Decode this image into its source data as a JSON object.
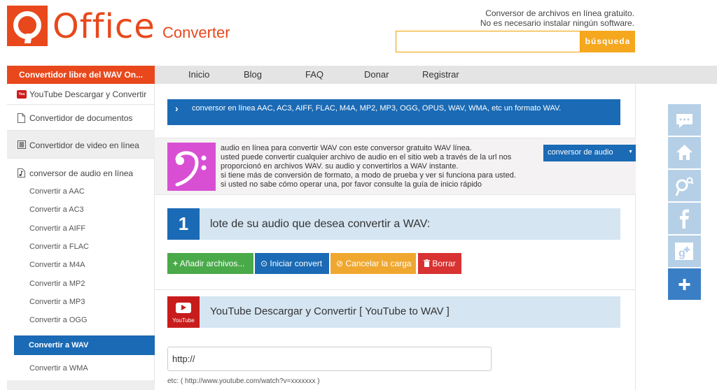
{
  "header": {
    "logo_office": "Office",
    "logo_converter": "Converter",
    "tagline_line1": "Conversor de archivos en línea gratuito.",
    "tagline_line2": "No es necesario instalar ningún software.",
    "search_placeholder": "",
    "search_button": "búsqueda"
  },
  "nav": {
    "items": [
      "Inicio",
      "Blog",
      "FAQ",
      "Donar",
      "Registrar"
    ]
  },
  "sidebar": {
    "heading": "Convertidor libre del WAV On...",
    "youtube": "YouTube Descargar y Convertir",
    "documents": "Convertidor de documentos",
    "video": "Convertidor de video en línea",
    "audio": "conversor de audio en línea",
    "sub_items": [
      "Convertir a AAC",
      "Convertir a AC3",
      "Convertir a AIFF",
      "Convertir a FLAC",
      "Convertir a M4A",
      "Convertir a MP2",
      "Convertir a MP3",
      "Convertir a OGG"
    ],
    "active_item": "Convertir a WAV",
    "after_item": "Convertir a WMA"
  },
  "main": {
    "banner": "conversor en línea AAC, AC3, AIFF, FLAC, M4A, MP2, MP3, OGG, OPUS, WAV, WMA, etc un formato WAV.",
    "description": [
      "audio en línea para convertir WAV con este conversor gratuito WAV línea.",
      "usted puede convertir cualquier archivo de audio en el sitio web a través de la url nos",
      "proporcionó en archivos WAV. su audio y convertirlos a WAV instante.",
      "si tiene más de conversión de formato, a modo de prueba y ver si funciona para usted.",
      "si usted no sabe cómo operar una, por favor consulte la guía de inicio rápido"
    ],
    "audio_dropdown": "conversor de audio",
    "step_number": "1",
    "step_text": "lote de su audio que desea convertir a WAV:",
    "buttons": {
      "add": "Añadir archivos...",
      "start": "Iniciar convert",
      "cancel": "Cancelar la carga",
      "clear": "Borrar"
    },
    "youtube_logo_text": "YouTube",
    "youtube_heading": "YouTube Descargar y Convertir [ YouTube to WAV ]",
    "url_value": "http://",
    "example": "etc: ( http://www.youtube.com/watch?v=xxxxxxx )"
  },
  "share": {
    "icons": [
      "comment-icon",
      "home-icon",
      "search-pin-icon",
      "facebook-icon",
      "google-plus-icon",
      "plus-icon"
    ]
  },
  "colors": {
    "brand": "#e8481c",
    "primary": "#1a6ab5",
    "accent": "#f5a71e"
  }
}
